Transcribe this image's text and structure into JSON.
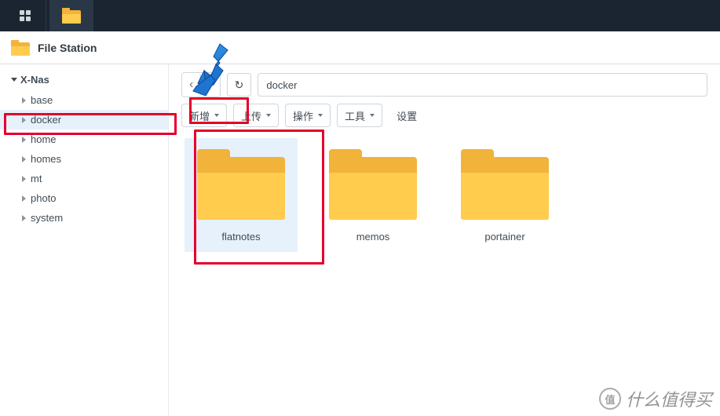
{
  "header": {
    "title": "File Station"
  },
  "sidebar": {
    "root_label": "X-Nas",
    "items": [
      {
        "label": "base",
        "selected": false
      },
      {
        "label": "docker",
        "selected": true
      },
      {
        "label": "home",
        "selected": false
      },
      {
        "label": "homes",
        "selected": false
      },
      {
        "label": "mt",
        "selected": false
      },
      {
        "label": "photo",
        "selected": false
      },
      {
        "label": "system",
        "selected": false
      }
    ]
  },
  "toolbar": {
    "path_value": "docker",
    "new_label": "新增",
    "upload_label": "上传",
    "action_label": "操作",
    "tools_label": "工具",
    "settings_label": "设置"
  },
  "files": [
    {
      "name": "flatnotes",
      "selected": true
    },
    {
      "name": "memos",
      "selected": false
    },
    {
      "name": "portainer",
      "selected": false
    }
  ],
  "watermark": {
    "badge": "值",
    "text": "什么值得买"
  }
}
